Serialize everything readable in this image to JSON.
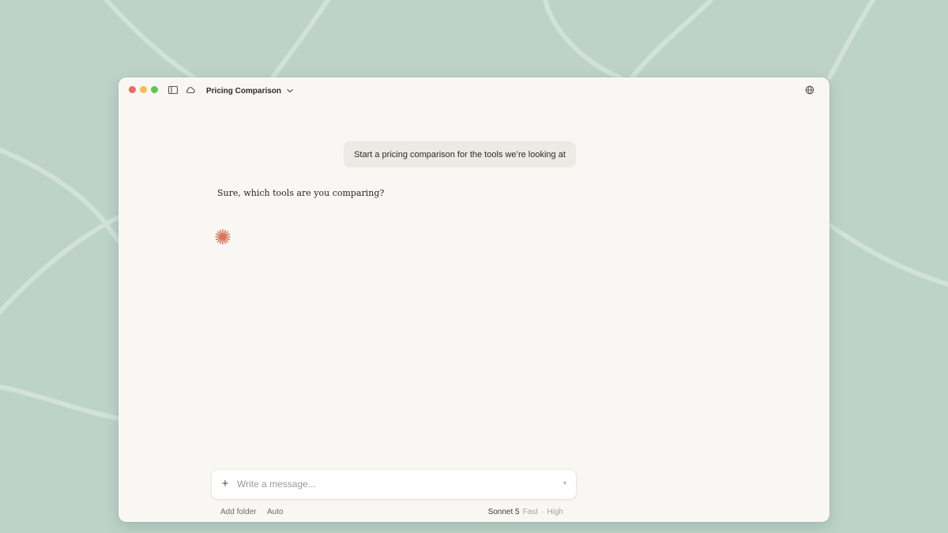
{
  "colors": {
    "background": "#bdd3ca",
    "window": "#f8f7f4",
    "user_bubble": "#ebeae5",
    "accent_spark": "#d8735a"
  },
  "titlebar": {
    "title": "Pricing Comparison",
    "icons": [
      "sidebar-toggle-icon",
      "cloud-icon",
      "chevron-down-icon",
      "globe-icon"
    ]
  },
  "conversation": {
    "user_message": "Start a pricing comparison for the tools we’re looking at",
    "assistant_message": "Sure, which tools are you comparing?",
    "thinking_indicator": "spark-icon"
  },
  "composer": {
    "add_symbol": "+",
    "placeholder": "Write a message...",
    "send_indicator": "▼"
  },
  "footer": {
    "add_folder": "Add folder",
    "mode": "Auto",
    "model": "Sonnet 5",
    "speed": "Fast",
    "separator": "·",
    "effort": "High"
  }
}
